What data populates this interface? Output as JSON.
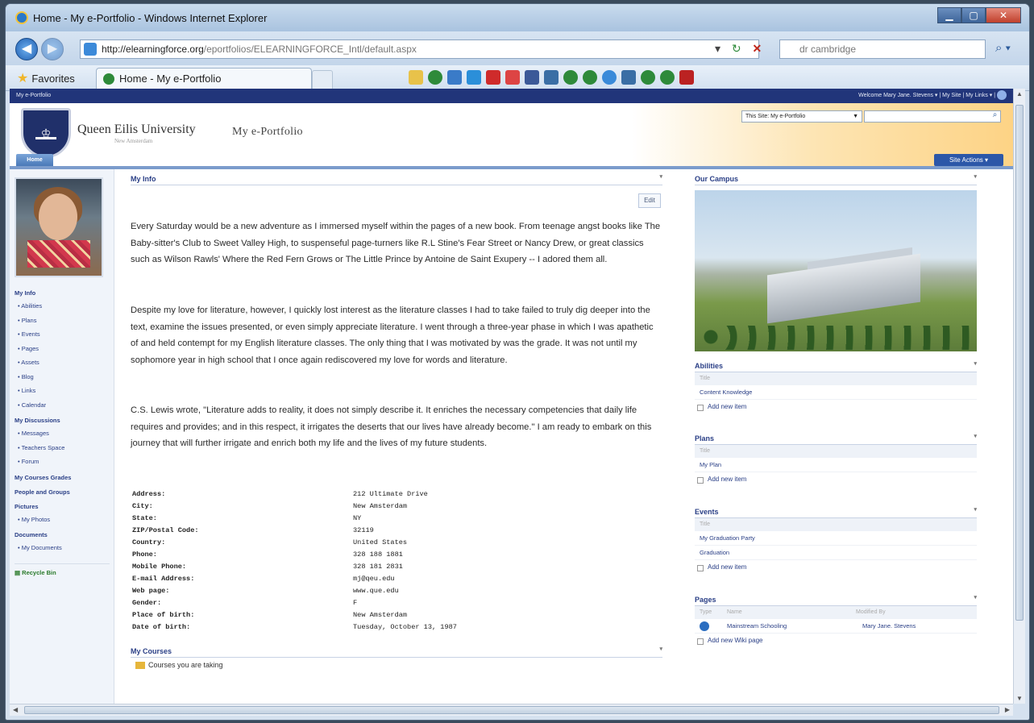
{
  "window": {
    "title": "Home - My e-Portfolio - Windows Internet Explorer"
  },
  "address_bar": {
    "url_host": "http://elearningforce.org",
    "url_path": "/eportfolios/ELEARNINGFORCE_Intl/default.aspx",
    "search_text": "dr cambridge"
  },
  "favorites_bar": {
    "favorites_label": "Favorites",
    "tab_label": "Home - My e-Portfolio"
  },
  "site": {
    "top_left": "My e-Portfolio",
    "welcome": "Welcome Mary Jane. Stevens ▾",
    "my_site": "My Site",
    "my_links": "My Links ▾",
    "university": "Queen Eilis University",
    "university_sub": "New Amsterdam",
    "portfolio_title": "My e-Portfolio",
    "search_scope": "This Site: My e-Portfolio",
    "home_tab": "Home",
    "site_actions": "Site Actions ▾"
  },
  "left_nav": {
    "my_info": "My Info",
    "my_info_items": [
      "Abilities",
      "Plans",
      "Events",
      "Pages",
      "Assets",
      "Blog",
      "Links",
      "Calendar"
    ],
    "my_discussions": "My Discussions",
    "discussion_items": [
      "Messages",
      "Teachers Space",
      "Forum"
    ],
    "my_courses_grades": "My Courses Grades",
    "people_and_groups": "People and Groups",
    "pictures": "Pictures",
    "picture_items": [
      "My Photos"
    ],
    "documents": "Documents",
    "document_items": [
      "My Documents"
    ],
    "recycle_bin": "Recycle Bin"
  },
  "my_info": {
    "title": "My Info",
    "edit": "Edit",
    "para1": "Every Saturday would be a new adventure as I immersed myself within the pages of a new book.  From teenage angst books like The Baby-sitter's Club to Sweet Valley High, to suspenseful page-turners like R.L Stine's Fear Street or Nancy Drew, or great classics such as Wilson Rawls' Where the Red Fern Grows or The Little Prince by Antoine de Saint Exupery -- I adored them all.",
    "para2": "Despite my love for literature, however, I quickly lost interest as the literature classes I had to take failed to truly dig deeper into the text, examine the issues presented, or even simply appreciate literature.  I went through a three-year phase in which I was apathetic of and held contempt for my English literature classes.  The only thing that I was motivated by was the grade.  It was not until my sophomore year in high school that I once again rediscovered my love for words and literature.",
    "para3": "C.S. Lewis wrote, \"Literature adds to reality, it does not simply describe it.  It enriches the necessary competencies that daily life requires and provides; and in this respect, it irrigates the deserts that our lives have already become.\"  I am ready to embark on this journey that will further irrigate and enrich both my life and the lives of my future students.",
    "details": [
      {
        "label": "Address:",
        "value": "212 Ultimate Drive"
      },
      {
        "label": "City:",
        "value": "New Amsterdam"
      },
      {
        "label": "State:",
        "value": "NY"
      },
      {
        "label": "ZIP/Postal Code:",
        "value": "32119"
      },
      {
        "label": "Country:",
        "value": "United States"
      },
      {
        "label": "Phone:",
        "value": "328 188 1881"
      },
      {
        "label": "Mobile Phone:",
        "value": "328 181 2831"
      },
      {
        "label": "E-mail Address:",
        "value": "mj@qeu.edu"
      },
      {
        "label": "Web page:",
        "value": "www.que.edu"
      },
      {
        "label": "Gender:",
        "value": "F"
      },
      {
        "label": "Place of birth:",
        "value": "New Amsterdam"
      },
      {
        "label": "Date of birth:",
        "value": "Tuesday, October 13, 1987"
      }
    ]
  },
  "my_courses": {
    "title": "My Courses",
    "taking": "Courses you are taking"
  },
  "right": {
    "campus_title": "Our Campus",
    "abilities": {
      "title": "Abilities",
      "col": "Title",
      "items": [
        "Content Knowledge"
      ],
      "add": "Add new item"
    },
    "plans": {
      "title": "Plans",
      "col": "Title",
      "items": [
        "My Plan"
      ],
      "add": "Add new item"
    },
    "events": {
      "title": "Events",
      "col": "Title",
      "items": [
        "My Graduation Party",
        "Graduation"
      ],
      "add": "Add new item"
    },
    "pages": {
      "title": "Pages",
      "col_type": "Type",
      "col_name": "Name",
      "col_modified": "Modified By",
      "row_name": "Mainstream Schooling",
      "row_modified": "Mary Jane. Stevens",
      "add": "Add new Wiki page"
    }
  }
}
